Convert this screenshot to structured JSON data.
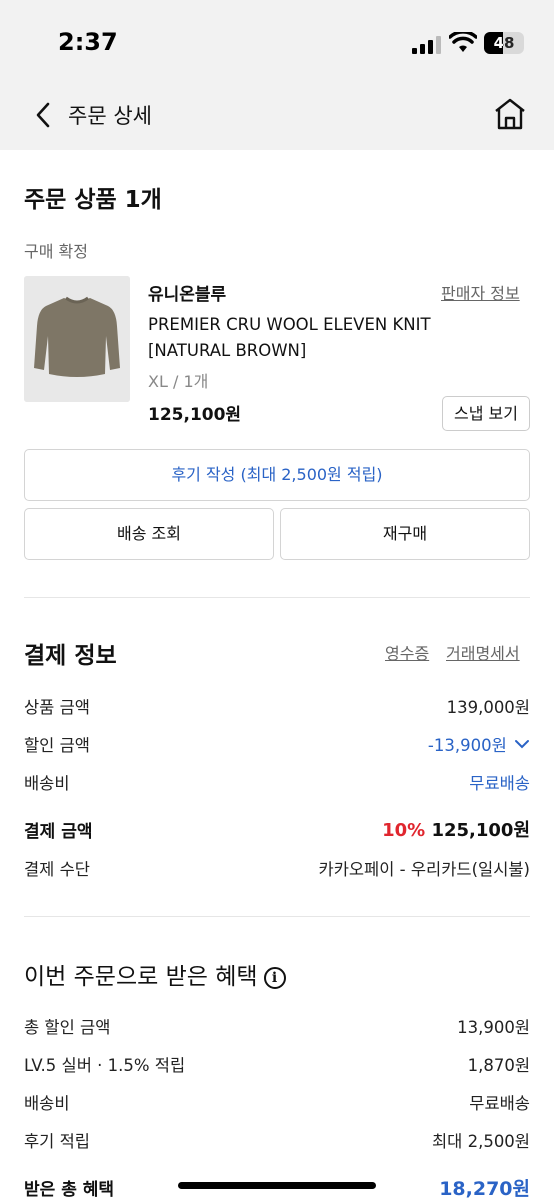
{
  "status_bar": {
    "time": "2:37",
    "battery": "48",
    "battery_level": 0.48
  },
  "nav": {
    "title": "주문 상세",
    "back_icon": "chevron-left-icon",
    "home_icon": "home-icon"
  },
  "order": {
    "heading": "주문 상품 1개",
    "status": "구매 확정",
    "product": {
      "brand": "유니온블루",
      "seller_info_label": "판매자 정보",
      "name": "PREMIER CRU WOOL ELEVEN KNIT [NATURAL BROWN]",
      "option": "XL / 1개",
      "price": "125,100원",
      "snap_label": "스냅 보기"
    },
    "review_button": "후기 작성 (최대 2,500원 적립)",
    "shipping_button": "배송 조회",
    "rebuy_button": "재구매"
  },
  "payment": {
    "heading": "결제 정보",
    "receipt_link": "영수증",
    "statement_link": "거래명세서",
    "rows": [
      {
        "label": "상품 금액",
        "value": "139,000원"
      },
      {
        "label": "할인 금액",
        "value": "-13,900원"
      },
      {
        "label": "배송비",
        "value": "무료배송"
      }
    ],
    "total_label": "결제 금액",
    "total_rate": "10%",
    "total_value": "125,100원",
    "method_label": "결제 수단",
    "method_value": "카카오페이 - 우리카드(일시불)"
  },
  "benefits": {
    "heading": "이번 주문으로 받은 혜택",
    "rows": [
      {
        "label": "총 할인 금액",
        "value": "13,900원"
      },
      {
        "label": "LV.5 실버 · 1.5% 적립",
        "value": "1,870원"
      },
      {
        "label": "배송비",
        "value": "무료배송"
      },
      {
        "label": "후기 적립",
        "value": "최대 2,500원"
      }
    ],
    "total_label": "받은 총 혜택",
    "total_value": "18,270원"
  },
  "colors": {
    "accent_blue": "#2a63c6",
    "discount_red": "#e0262e",
    "header_bg": "#f2f2f2"
  }
}
